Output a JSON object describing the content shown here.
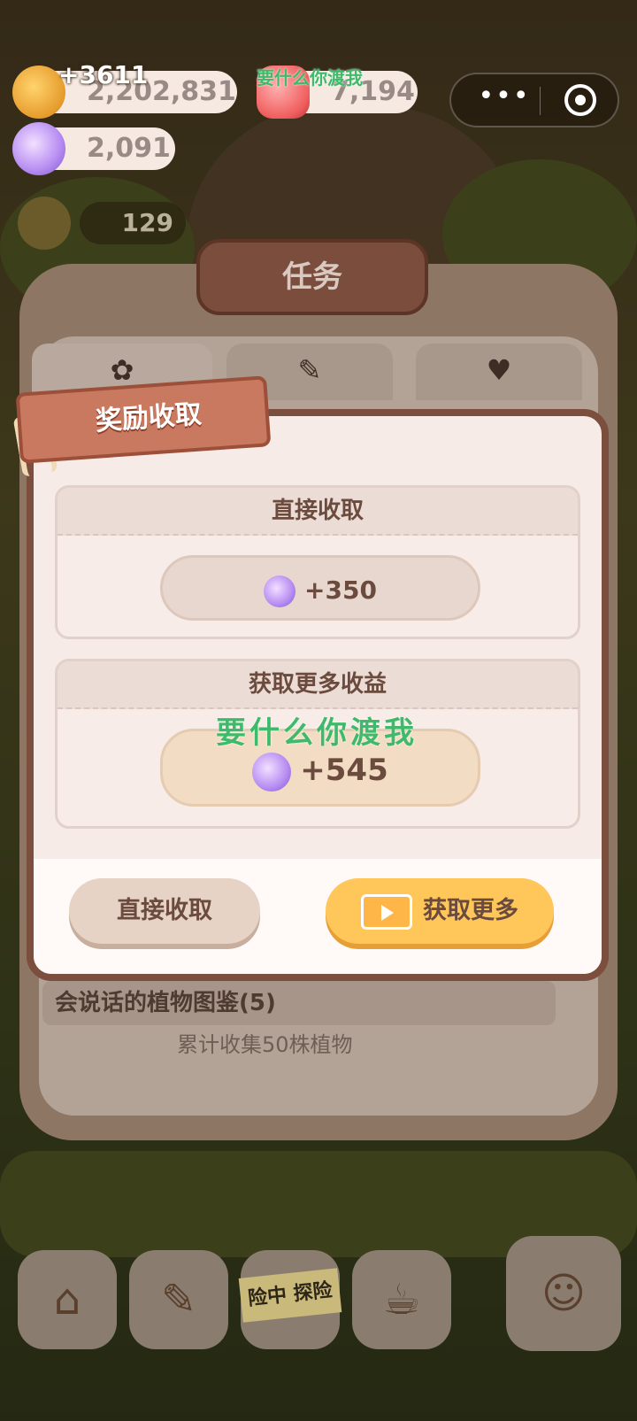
{
  "hud": {
    "coins": "2,202,831",
    "coin_gain": "+3611",
    "gems": "7,194",
    "candies": "2,091",
    "sun_count": "129",
    "menu_dots": "•••"
  },
  "task_panel": {
    "title": "任务",
    "tabs": [
      "paw-icon",
      "note-icon",
      "perfume-icon"
    ],
    "item_title": "会说话的植物图鉴(5)",
    "item_desc": "累计收集50株植物"
  },
  "reward_dialog": {
    "ribbon_title": "奖励收取",
    "direct": {
      "header": "直接收取",
      "amount": "+350"
    },
    "more": {
      "header": "获取更多收益",
      "amount": "+545"
    },
    "buttons": {
      "collect": "直接收取",
      "get_more": "获取更多"
    }
  },
  "bottom_nav": {
    "banner": "险中 探险"
  },
  "watermarks": {
    "top": "要什么你渡我",
    "middle": "要什么你渡我"
  },
  "colors": {
    "dialog_border": "#7b4e3d",
    "accent_button": "#ffc65a",
    "plain_button": "#e6d3c6"
  }
}
